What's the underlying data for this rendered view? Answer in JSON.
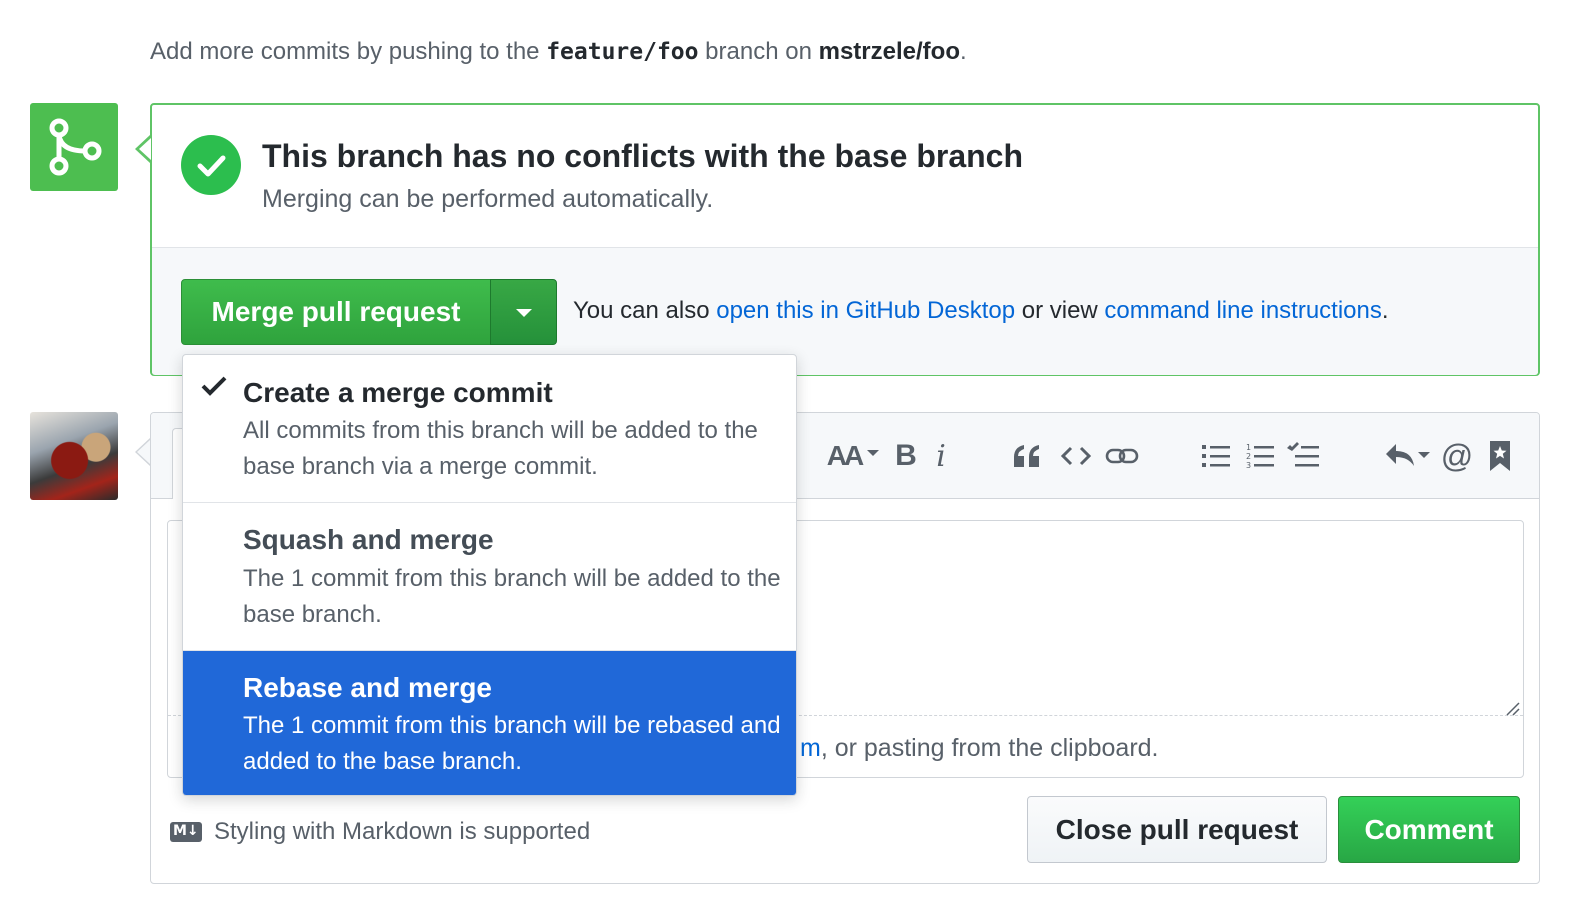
{
  "top_note": {
    "prefix": "Add more commits by pushing to the ",
    "branch": "feature/foo",
    "middle": " branch on ",
    "repo": "mstrzele/foo",
    "suffix": "."
  },
  "merge_status": {
    "title": "This branch has no conflicts with the base branch",
    "subtitle": "Merging can be performed automatically.",
    "icon_color": "#4dbe50"
  },
  "merge_actions": {
    "merge_button": "Merge pull request",
    "also_prefix": "You can also ",
    "desktop_link": "open this in GitHub Desktop",
    "also_middle": " or view ",
    "cli_link": "command line instructions",
    "also_suffix": "."
  },
  "merge_menu": {
    "items": [
      {
        "title": "Create a merge commit",
        "description": "All commits from this branch will be added to the base branch via a merge commit.",
        "checked": true
      },
      {
        "title": "Squash and merge",
        "description": "The 1 commit from this branch will be added to the base branch."
      },
      {
        "title": "Rebase and merge",
        "description": "The 1 commit from this branch will be rebased and added to the base branch."
      }
    ],
    "highlight_color": "#2068d8"
  },
  "toolbar": {
    "header_label": "AA",
    "bold_label": "B",
    "italic_label": "i"
  },
  "comment": {
    "drop_link_fragment": "m",
    "drop_text": ", or pasting from the clipboard.",
    "markdown_badge": "M↓",
    "markdown_note": "Styling with Markdown is supported",
    "close_button": "Close pull request",
    "comment_button": "Comment"
  }
}
